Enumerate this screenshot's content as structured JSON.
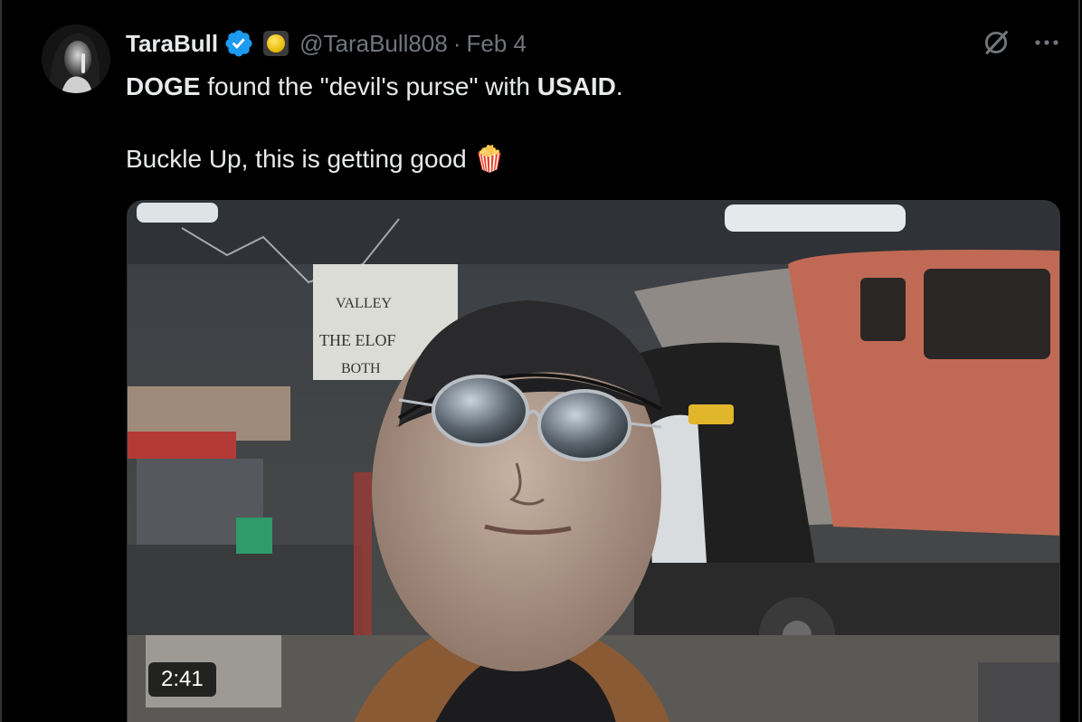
{
  "tweet": {
    "author_name": "TaraBull",
    "handle": "@TaraBull808",
    "separator": "·",
    "date": "Feb 4",
    "text_line1": {
      "part1": "DOGE",
      "part2": " found the \"devil's purse\" with ",
      "part3": "USAID",
      "part4": "."
    },
    "text_line2": {
      "text": "Buckle Up, this is getting good ",
      "emoji": "🍿"
    },
    "video": {
      "duration": "2:41",
      "sign_lines": [
        "THE ELOF",
        "VALLEY",
        "BOTH"
      ]
    }
  },
  "colors": {
    "background": "#000000",
    "text_primary": "#e7e9ea",
    "text_secondary": "#71767b",
    "verified_blue": "#1d9bf0",
    "border": "#2f3336"
  },
  "icons": {
    "verified": "verified-badge-icon",
    "affiliate": "gold-coin-badge-icon",
    "grok": "grok-icon",
    "more": "more-options-icon"
  }
}
